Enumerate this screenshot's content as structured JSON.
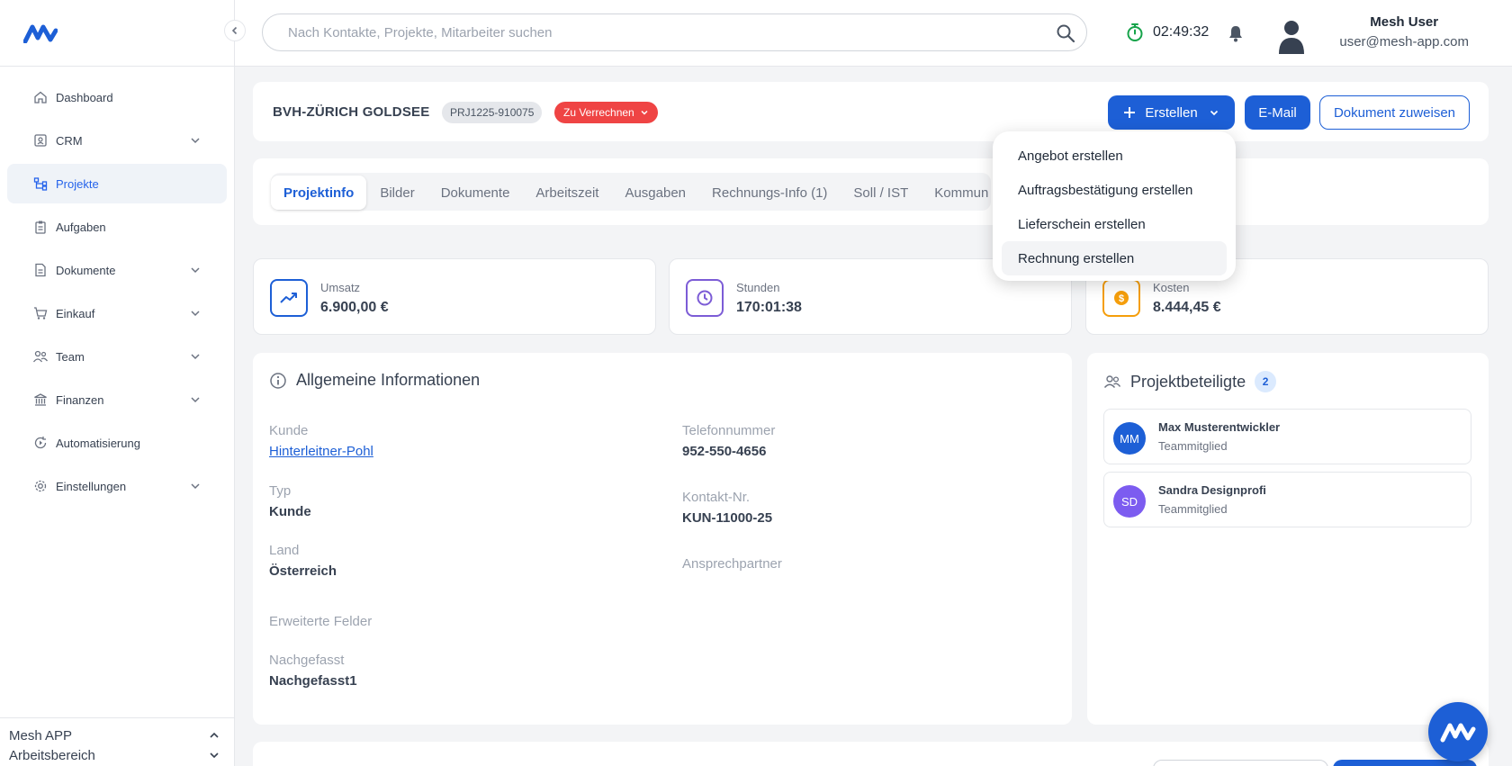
{
  "search": {
    "placeholder": "Nach Kontakte, Projekte, Mitarbeiter suchen"
  },
  "timer": {
    "value": "02:49:32"
  },
  "user": {
    "name": "Mesh User",
    "email": "user@mesh-app.com"
  },
  "sidebar": {
    "items": [
      {
        "label": "Dashboard",
        "icon": "home-icon"
      },
      {
        "label": "CRM",
        "icon": "contact-card-icon"
      },
      {
        "label": "Projekte",
        "icon": "project-tree-icon"
      },
      {
        "label": "Aufgaben",
        "icon": "clipboard-icon"
      },
      {
        "label": "Dokumente",
        "icon": "document-icon"
      },
      {
        "label": "Einkauf",
        "icon": "cart-icon"
      },
      {
        "label": "Team",
        "icon": "team-icon"
      },
      {
        "label": "Finanzen",
        "icon": "bank-icon"
      },
      {
        "label": "Automatisierung",
        "icon": "automation-icon"
      },
      {
        "label": "Einstellungen",
        "icon": "gear-icon"
      }
    ],
    "footer": {
      "app": "Mesh APP",
      "workspace": "Arbeitsbereich"
    }
  },
  "project": {
    "title": "BVH-ZÜRICH GOLDSEE",
    "code": "PRJ1225-910075",
    "status": "Zu Verrechnen",
    "buttons": {
      "create": "Erstellen",
      "email": "E-Mail",
      "assign": "Dokument zuweisen"
    }
  },
  "tabs": [
    "Projektinfo",
    "Bilder",
    "Dokumente",
    "Arbeitszeit",
    "Ausgaben",
    "Rechnungs-Info (1)",
    "Soll / IST",
    "Kommun"
  ],
  "dropdown": {
    "items": [
      "Angebot erstellen",
      "Auftragsbestätigung erstellen",
      "Lieferschein erstellen",
      "Rechnung erstellen"
    ]
  },
  "stats": [
    {
      "label": "Umsatz",
      "value": "6.900,00 €",
      "color": "#1d5fd6"
    },
    {
      "label": "Stunden",
      "value": "170:01:38",
      "color": "#7c5cd6"
    },
    {
      "label": "Kosten",
      "value": "8.444,45 €",
      "color": "#f59e0b"
    }
  ],
  "info": {
    "title": "Allgemeine Informationen",
    "kunde_label": "Kunde",
    "kunde_value": "Hinterleitner-Pohl",
    "typ_label": "Typ",
    "typ_value": "Kunde",
    "land_label": "Land",
    "land_value": "Österreich",
    "erweitert_label": "Erweiterte Felder",
    "nachgefasst_label": "Nachgefasst",
    "nachgefasst_value": "Nachgefasst1",
    "telefon_label": "Telefonnummer",
    "telefon_value": "952-550-4656",
    "kontakt_label": "Kontakt-Nr.",
    "kontakt_value": "KUN-11000-25",
    "ansprech_label": "Ansprechpartner"
  },
  "participants": {
    "title": "Projektbeteiligte",
    "count": "2",
    "people": [
      {
        "initials": "MM",
        "name": "Max Musterentwickler",
        "role": "Teammitglied",
        "color": "#1d5fd6"
      },
      {
        "initials": "SD",
        "name": "Sandra Designprofi",
        "role": "Teammitglied",
        "color": "#7c5cf0"
      }
    ]
  }
}
